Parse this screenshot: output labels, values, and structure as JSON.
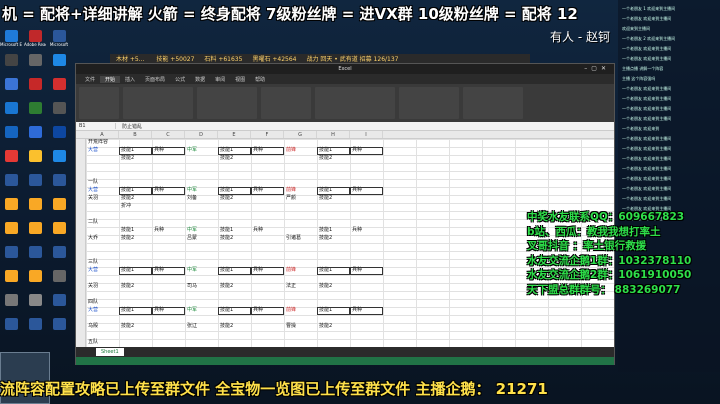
{
  "top_banner": "机 = 配将+详细讲解  火箭 = 终身配将  7级粉丝牌 = 进VX群  10级粉丝牌 = 配将 12",
  "host_label": "有人 - 赵钶",
  "stream_bar": [
    "木材 +5... ",
    "技能 +50027",
    "石料 +61635",
    "黑曜石 +42564",
    "战力 回天 • 武有道  招募 126/137"
  ],
  "desktop_icons": [
    {
      "label": "Microsoft Edge",
      "color": "#1f7ad8"
    },
    {
      "label": "Adobe Reader XI",
      "color": "#c0282a"
    },
    {
      "label": "Microsoft",
      "color": "#2b579a"
    },
    {
      "label": "",
      "color": "#444"
    },
    {
      "label": "",
      "color": "#666"
    },
    {
      "label": "",
      "color": "#1e88e5"
    },
    {
      "label": "",
      "color": "#3b74d6"
    },
    {
      "label": "",
      "color": "#c62828"
    },
    {
      "label": "",
      "color": "#d32f2f"
    },
    {
      "label": "",
      "color": "#1976d2"
    },
    {
      "label": "",
      "color": "#2e7d32"
    },
    {
      "label": "",
      "color": "#555"
    },
    {
      "label": "",
      "color": "#1565c0"
    },
    {
      "label": "",
      "color": "#2e6bd8"
    },
    {
      "label": "",
      "color": "#0d47a1"
    },
    {
      "label": "",
      "color": "#e53935"
    },
    {
      "label": "",
      "color": "#fbc02d"
    },
    {
      "label": "",
      "color": "#1e88e5"
    },
    {
      "label": "",
      "color": "#2b579a"
    },
    {
      "label": "",
      "color": "#2b579a"
    },
    {
      "label": "",
      "color": "#2b579a"
    },
    {
      "label": "",
      "color": "#f9a825"
    },
    {
      "label": "",
      "color": "#f9a825"
    },
    {
      "label": "",
      "color": "#f9a825"
    },
    {
      "label": "",
      "color": "#f9a825"
    },
    {
      "label": "",
      "color": "#f9a825"
    },
    {
      "label": "",
      "color": "#f9a825"
    },
    {
      "label": "",
      "color": "#2b579a"
    },
    {
      "label": "",
      "color": "#2b579a"
    },
    {
      "label": "",
      "color": "#2b579a"
    },
    {
      "label": "",
      "color": "#f9a825"
    },
    {
      "label": "",
      "color": "#f9a825"
    },
    {
      "label": "",
      "color": "#666"
    },
    {
      "label": "",
      "color": "#777"
    },
    {
      "label": "",
      "color": "#888"
    },
    {
      "label": "",
      "color": "#2b579a"
    },
    {
      "label": "",
      "color": "#2b579a"
    },
    {
      "label": "",
      "color": "#2b579a"
    },
    {
      "label": "",
      "color": "#2b579a"
    }
  ],
  "excel": {
    "title": "Excel",
    "tabs": [
      "文件",
      "开始",
      "插入",
      "页面布局",
      "公式",
      "数据",
      "审阅",
      "视图",
      "帮助"
    ],
    "formula": {
      "cellref": "B1",
      "value": "防止错乱"
    },
    "columns": [
      "A",
      "B",
      "C",
      "D",
      "E",
      "F",
      "G",
      "H",
      "I"
    ],
    "sheet_tab": "Sheet1",
    "cells": [
      {
        "text": "开荒阵容",
        "cls": ""
      },
      {
        "text": "大营",
        "cls": "blue"
      },
      {
        "text": "技能1",
        "cls": ""
      },
      {
        "text": "兵种",
        "cls": ""
      },
      {
        "text": "中军",
        "cls": "green"
      },
      {
        "text": "技能1",
        "cls": ""
      },
      {
        "text": "兵种",
        "cls": ""
      },
      {
        "text": "前锋",
        "cls": "red"
      },
      {
        "text": "技能1",
        "cls": ""
      },
      {
        "text": "兵种",
        "cls": ""
      },
      {
        "text": "技能2",
        "cls": ""
      },
      {
        "text": "技能2",
        "cls": ""
      },
      {
        "text": "技能2",
        "cls": ""
      },
      {
        "text": "一队",
        "cls": ""
      },
      {
        "text": "大营",
        "cls": "blue"
      },
      {
        "text": "技能1",
        "cls": ""
      },
      {
        "text": "兵种",
        "cls": ""
      },
      {
        "text": "中军",
        "cls": "green"
      },
      {
        "text": "技能1",
        "cls": ""
      },
      {
        "text": "兵种",
        "cls": ""
      },
      {
        "text": "前锋",
        "cls": "red"
      },
      {
        "text": "技能1",
        "cls": ""
      },
      {
        "text": "兵种",
        "cls": ""
      },
      {
        "text": "关羽",
        "cls": ""
      },
      {
        "text": "技能2",
        "cls": ""
      },
      {
        "text": "刘备",
        "cls": ""
      },
      {
        "text": "技能2",
        "cls": ""
      },
      {
        "text": "严颜",
        "cls": ""
      },
      {
        "text": "技能2",
        "cls": ""
      },
      {
        "text": "折冲",
        "cls": ""
      },
      {
        "text": "二队",
        "cls": ""
      },
      {
        "text": "技能1",
        "cls": ""
      },
      {
        "text": "兵种",
        "cls": ""
      },
      {
        "text": "中军",
        "cls": "green"
      },
      {
        "text": "技能1",
        "cls": ""
      },
      {
        "text": "兵种",
        "cls": ""
      },
      {
        "text": "技能1",
        "cls": ""
      },
      {
        "text": "兵种",
        "cls": ""
      },
      {
        "text": "大乔",
        "cls": ""
      },
      {
        "text": "技能2",
        "cls": ""
      },
      {
        "text": "吕蒙",
        "cls": ""
      },
      {
        "text": "技能2",
        "cls": ""
      },
      {
        "text": "引诸葛",
        "cls": ""
      },
      {
        "text": "技能2",
        "cls": ""
      },
      {
        "text": "三队",
        "cls": ""
      },
      {
        "text": "大营",
        "cls": "blue"
      },
      {
        "text": "技能1",
        "cls": ""
      },
      {
        "text": "兵种",
        "cls": ""
      },
      {
        "text": "中军",
        "cls": "green"
      },
      {
        "text": "技能1",
        "cls": ""
      },
      {
        "text": "兵种",
        "cls": ""
      },
      {
        "text": "前锋",
        "cls": "red"
      },
      {
        "text": "技能1",
        "cls": ""
      },
      {
        "text": "兵种",
        "cls": ""
      },
      {
        "text": "关羽",
        "cls": ""
      },
      {
        "text": "技能2",
        "cls": ""
      },
      {
        "text": "司马",
        "cls": ""
      },
      {
        "text": "技能2",
        "cls": ""
      },
      {
        "text": "法正",
        "cls": ""
      },
      {
        "text": "技能2",
        "cls": ""
      },
      {
        "text": "四队",
        "cls": ""
      },
      {
        "text": "大营",
        "cls": "blue"
      },
      {
        "text": "技能1",
        "cls": ""
      },
      {
        "text": "兵种",
        "cls": ""
      },
      {
        "text": "中军",
        "cls": "green"
      },
      {
        "text": "技能1",
        "cls": ""
      },
      {
        "text": "兵种",
        "cls": ""
      },
      {
        "text": "前锋",
        "cls": "red"
      },
      {
        "text": "技能1",
        "cls": ""
      },
      {
        "text": "兵种",
        "cls": ""
      },
      {
        "text": "乌殿",
        "cls": ""
      },
      {
        "text": "技能2",
        "cls": ""
      },
      {
        "text": "张辽",
        "cls": ""
      },
      {
        "text": "技能2",
        "cls": ""
      },
      {
        "text": "曹操",
        "cls": ""
      },
      {
        "text": "技能2",
        "cls": ""
      },
      {
        "text": "五队",
        "cls": ""
      },
      {
        "text": "大营",
        "cls": "blue"
      },
      {
        "text": "技能1",
        "cls": ""
      },
      {
        "text": "兵种",
        "cls": ""
      },
      {
        "text": "中军",
        "cls": "green"
      },
      {
        "text": "技能1",
        "cls": ""
      },
      {
        "text": "兵种",
        "cls": ""
      },
      {
        "text": "前锋",
        "cls": "red"
      },
      {
        "text": "技能1",
        "cls": ""
      },
      {
        "text": "兵种",
        "cls": ""
      }
    ]
  },
  "overlay_lines": [
    "中奖水友联系QQ：609667823",
    "b站、西瓜：教我我想打率土",
    "叉哥抖音 ：率土银行救援",
    "水友交流企鹅1群：1032378110",
    "水友交流企鹅2群：1061910050",
    "天下盟总群群号：   883269077"
  ],
  "bottom_banner": "流阵容配置攻略已上传至群文件  全宝物一览图已上传至群文件  主播企鹅：  21271",
  "chat_lines": [
    "一个老朋友 1 欢迎来到主播间",
    "一个老朋友 欢迎来到主播间",
    "欢迎来到主播间",
    "一个老朋友 2 欢迎来到主播间",
    "一个老朋友 欢迎来到主播间",
    "一个老朋友 欢迎来到主播间",
    "主播点播 讲解一个阵容",
    "主播  这个阵容强吗",
    "一个老朋友 欢迎来到主播间",
    "一个老朋友 欢迎来到主播间",
    "一个老朋友 欢迎来到主播间",
    "一个老朋友 欢迎来到主播间",
    "一个老朋友  欢迎来到",
    "一个老朋友 欢迎来到主播间",
    "一个老朋友 欢迎来到主播间",
    "一个老朋友 欢迎来到主播间",
    "一个老朋友 欢迎来到主播间",
    "一个老朋友 欢迎来到主播间",
    "一个老朋友 欢迎来到主播间",
    "一个老朋友 欢迎来到主播间",
    "一个老朋友 欢迎来到主播间",
    "一个老朋友 欢迎来到主播间"
  ]
}
